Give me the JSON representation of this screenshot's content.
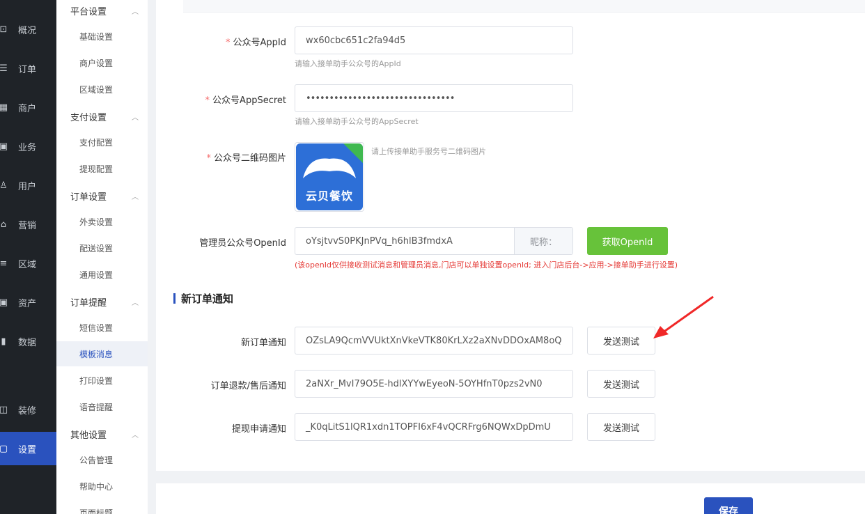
{
  "nav_primary": [
    {
      "label": "概况",
      "icon": "chart-icon"
    },
    {
      "label": "订单",
      "icon": "list-icon"
    },
    {
      "label": "商户",
      "icon": "store-icon"
    },
    {
      "label": "业务",
      "icon": "briefcase-icon"
    },
    {
      "label": "用户",
      "icon": "user-icon"
    },
    {
      "label": "营销",
      "icon": "shop-icon"
    },
    {
      "label": "区域",
      "icon": "database-icon"
    },
    {
      "label": "资产",
      "icon": "wallet-icon"
    },
    {
      "label": "数据",
      "icon": "bar-chart-icon"
    },
    {
      "label": "装修",
      "icon": "brush-icon"
    },
    {
      "label": "设置",
      "icon": "settings-icon",
      "active": true
    }
  ],
  "nav_secondary": {
    "groups": [
      "平台设置",
      "支付设置",
      "订单设置",
      "订单提醒",
      "其他设置"
    ],
    "items": [
      "基础设置",
      "商户设置",
      "区域设置",
      "支付配置",
      "提现配置",
      "外卖设置",
      "配送设置",
      "通用设置",
      "短信设置",
      "模板消息",
      "打印设置",
      "语音提醒",
      "公告管理",
      "帮助中心",
      "页面标题"
    ],
    "active": "模板消息"
  },
  "form": {
    "appid_label": "公众号AppId",
    "appid_value": "wx60cbc651c2fa94d5",
    "appid_hint": "请输入接单助手公众号的AppId",
    "secret_label": "公众号AppSecret",
    "secret_value": "••••••••••••••••••••••••••••••••",
    "secret_hint": "请输入接单助手公众号的AppSecret",
    "qr_label": "公众号二维码图片",
    "qr_hint": "请上传接单助手服务号二维码图片",
    "qr_logo_text": "云贝餐饮",
    "openid_label": "管理员公众号OpenId",
    "openid_value": "oYsjtvvS0PKJnPVq_h6hlB3fmdxA",
    "nickname_label": "昵称：",
    "get_openid_button": "获取OpenId",
    "openid_note": "(该openId仅供接收测试消息和管理员消息,门店可以单独设置openId; 进入门店后台->应用->接单助手进行设置)"
  },
  "new_order_section": {
    "title": "新订单通知",
    "rows": [
      {
        "label": "新订单通知",
        "value": "OZsLA9QcmVVUktXnVkeVTK80KrLXz2aXNvDDOxAM8oQ",
        "button": "发送测试"
      },
      {
        "label": "订单退款/售后通知",
        "value": "2aNXr_MvI79O5E-hdlXYYwEyeoN-5OYHfnT0pzs2vN0",
        "button": "发送测试"
      },
      {
        "label": "提现申请通知",
        "value": "_K0qLitS1lQR1xdn1TOPFI6xF4vQCRFrg6NQWxDpDmU",
        "button": "发送测试"
      }
    ]
  },
  "save_button": "保存",
  "colors": {
    "primary": "#2a52be",
    "success": "#67c23a",
    "danger": "#e53935",
    "nav_bg": "#1f2328"
  }
}
